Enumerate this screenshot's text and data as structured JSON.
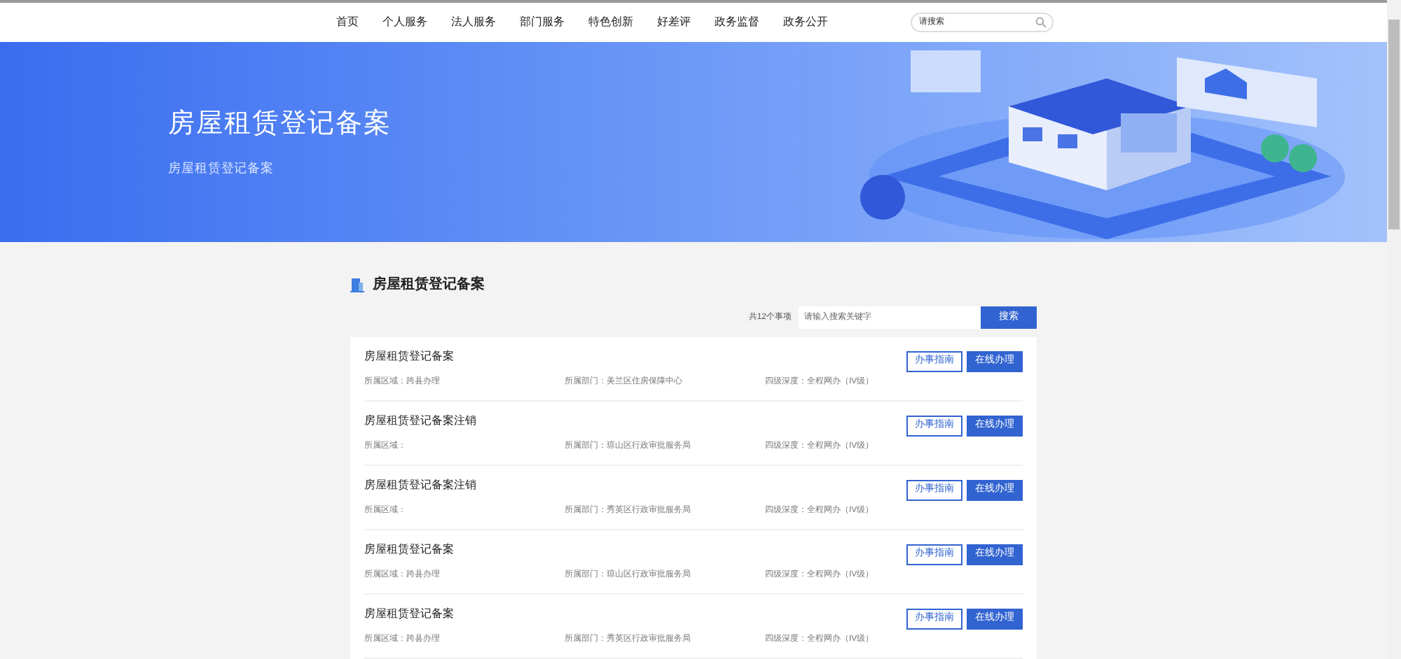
{
  "nav": {
    "items": [
      "首页",
      "个人服务",
      "法人服务",
      "部门服务",
      "特色创新",
      "好差评",
      "政务监督",
      "政务公开"
    ],
    "search_placeholder": "请搜索"
  },
  "banner": {
    "title": "房屋租赁登记备案",
    "subtitle": "房屋租赁登记备案"
  },
  "section": {
    "title": "房屋租赁登记备案",
    "count": "共12个事项",
    "search_placeholder": "请输入搜索关键字",
    "search_button": "搜索"
  },
  "items": [
    {
      "title": "房屋租赁登记备案",
      "region": "所属区域：跨县办理",
      "dept": "所属部门：美兰区住房保障中心",
      "depth": "四级深度：全程网办（IV级）",
      "buttons": [
        "办事指南",
        "在线办理"
      ]
    },
    {
      "title": "房屋租赁登记备案注销",
      "region": "所属区域：",
      "dept": "所属部门：琼山区行政审批服务局",
      "depth": "四级深度：全程网办（IV级）",
      "buttons": [
        "办事指南",
        "在线办理"
      ]
    },
    {
      "title": "房屋租赁登记备案注销",
      "region": "所属区域：",
      "dept": "所属部门：秀英区行政审批服务局",
      "depth": "四级深度：全程网办（IV级）",
      "buttons": [
        "办事指南",
        "在线办理"
      ]
    },
    {
      "title": "房屋租赁登记备案",
      "region": "所属区域：跨县办理",
      "dept": "所属部门：琼山区行政审批服务局",
      "depth": "四级深度：全程网办（IV级）",
      "buttons": [
        "办事指南",
        "在线办理"
      ]
    },
    {
      "title": "房屋租赁登记备案",
      "region": "所属区域：跨县办理",
      "dept": "所属部门：秀英区行政审批服务局",
      "depth": "四级深度：全程网办（IV级）",
      "buttons": [
        "办事指南",
        "在线办理"
      ]
    }
  ]
}
